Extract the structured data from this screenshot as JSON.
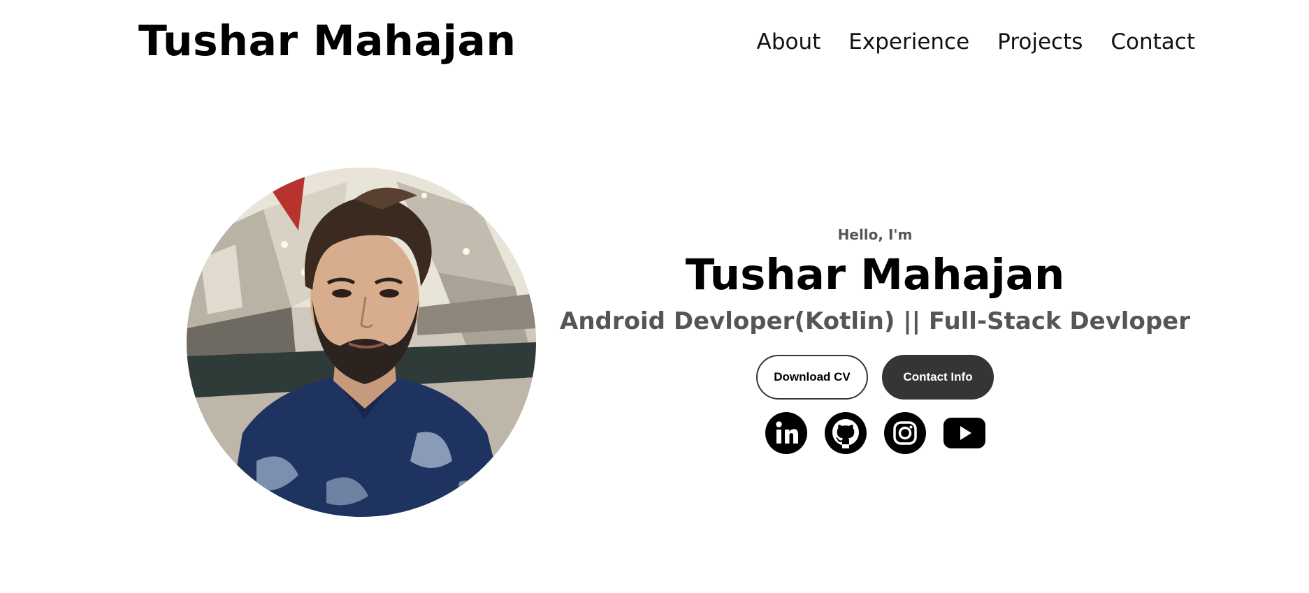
{
  "header": {
    "logo": "Tushar Mahajan",
    "nav": [
      {
        "label": "About"
      },
      {
        "label": "Experience"
      },
      {
        "label": "Projects"
      },
      {
        "label": "Contact"
      }
    ]
  },
  "hero": {
    "greeting": "Hello, I'm",
    "name": "Tushar Mahajan",
    "subtitle": "Android Devloper(Kotlin) || Full-Stack Devloper",
    "buttons": {
      "download_cv": "Download CV",
      "contact_info": "Contact Info"
    },
    "socials": [
      {
        "icon": "linkedin-icon"
      },
      {
        "icon": "github-icon"
      },
      {
        "icon": "instagram-icon"
      },
      {
        "icon": "youtube-icon"
      }
    ]
  },
  "colors": {
    "text": "#000000",
    "muted": "#555555",
    "button_dark": "#353535",
    "background": "#ffffff"
  }
}
